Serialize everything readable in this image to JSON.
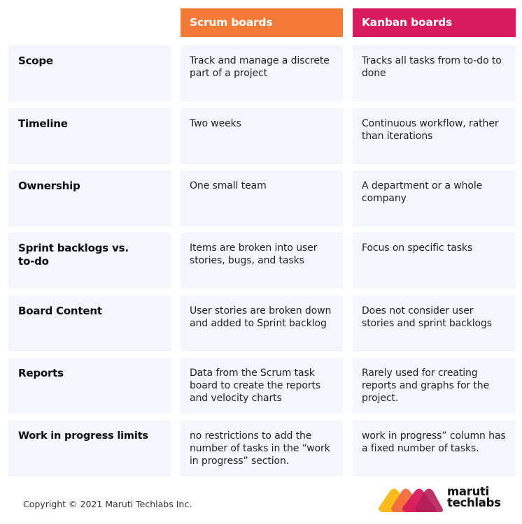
{
  "header": {
    "scrum": "Scrum boards",
    "kanban": "Kanban boards"
  },
  "colors": {
    "scrum_header": "#f47a38",
    "kanban_header": "#d81b5c",
    "cell_background": "#f3f6fa"
  },
  "rows": [
    {
      "label": "Scope",
      "scrum": "Track and manage a discrete part of a project",
      "kanban": "Tracks all tasks from to-do to done"
    },
    {
      "label": "Timeline",
      "scrum": "Two weeks",
      "kanban": "Continuous workflow, rather than iterations"
    },
    {
      "label": "Ownership",
      "scrum": "One small team",
      "kanban": "A department or a whole company"
    },
    {
      "label": "Sprint backlogs vs. to-do",
      "scrum": "Items are broken into user stories, bugs, and tasks",
      "kanban": "Focus on specific tasks"
    },
    {
      "label": "Board Content",
      "scrum": "User stories are broken down and added to Sprint backlog",
      "kanban": "Does not consider user stories and sprint backlogs"
    },
    {
      "label": "Reports",
      "scrum": "Data from the Scrum task board to create the reports and velocity charts",
      "kanban": "Rarely used for creating reports and graphs for the project."
    },
    {
      "label": "Work in progress limits",
      "scrum": "no restrictions to add the number of tasks in the “work in progress” section.",
      "kanban": "work in progress” column has a fixed number of tasks."
    }
  ],
  "footer": {
    "copyright": "Copyright © 2021 Maruti Techlabs Inc.",
    "logo_line1": "maruti",
    "logo_line2": "techlabs",
    "logo_icon": "maruti-techlabs-logo-icon"
  }
}
